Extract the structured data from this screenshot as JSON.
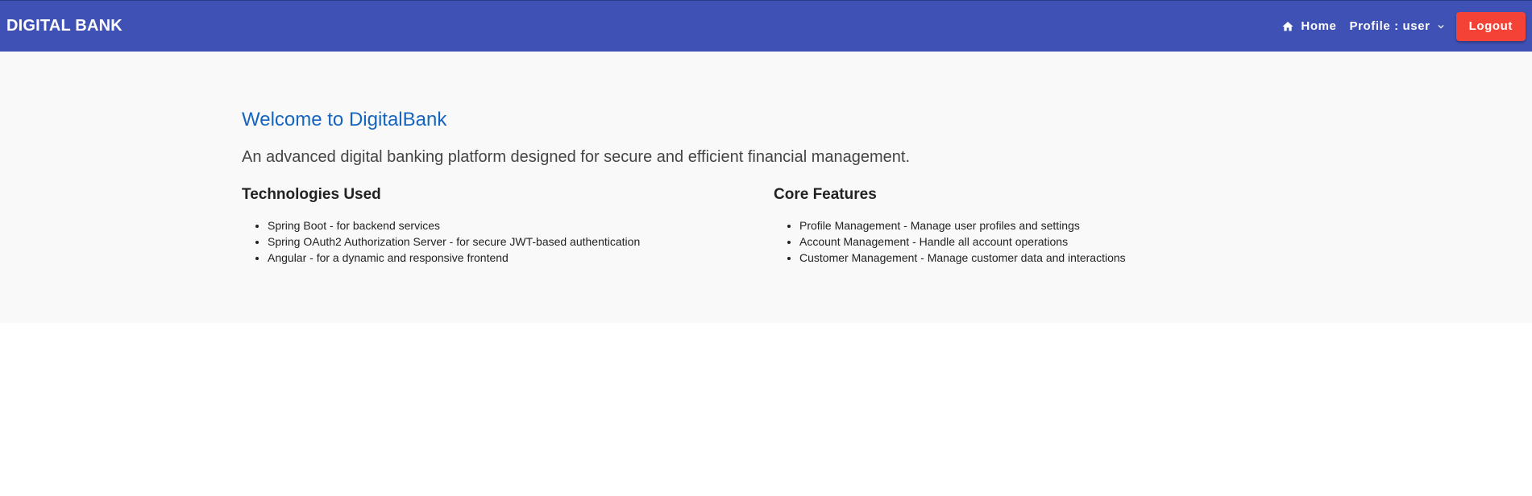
{
  "header": {
    "brand": "DIGITAL BANK",
    "home_label": "Home",
    "profile_label": "Profile : user",
    "logout_label": "Logout"
  },
  "main": {
    "title": "Welcome to DigitalBank",
    "subtitle": "An advanced digital banking platform designed for secure and efficient financial management.",
    "technologies": {
      "heading": "Technologies Used",
      "items": [
        "Spring Boot - for backend services",
        "Spring OAuth2 Authorization Server - for secure JWT-based authentication",
        "Angular - for a dynamic and responsive frontend"
      ]
    },
    "features": {
      "heading": "Core Features",
      "items": [
        "Profile Management - Manage user profiles and settings",
        "Account Management - Handle all account operations",
        "Customer Management - Manage customer data and interactions"
      ]
    }
  },
  "icons": {
    "home": "home-icon",
    "profile_menu": "chevron-down-icon"
  },
  "colors": {
    "toolbar": "#3f51b5",
    "logout": "#f44336",
    "title": "#1565c0",
    "hero_bg": "#f9f9f9"
  }
}
